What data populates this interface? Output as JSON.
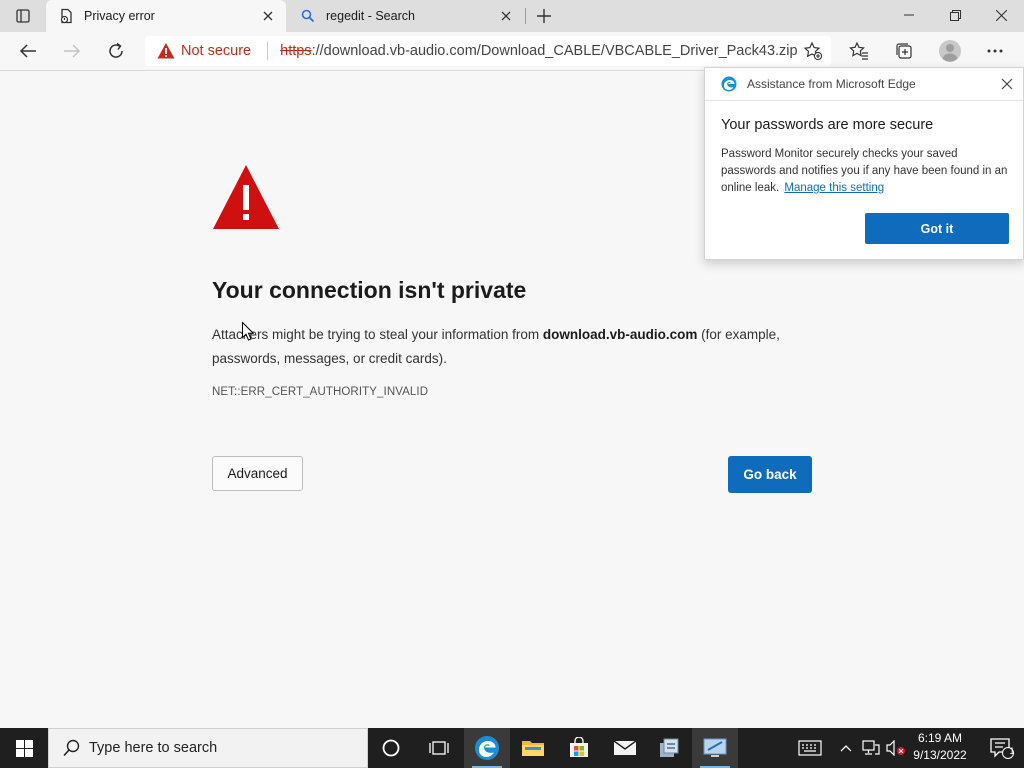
{
  "browser": {
    "tabs": [
      {
        "title": "Privacy error",
        "active": true
      },
      {
        "title": "regedit - Search",
        "active": false
      }
    ],
    "address": {
      "security_label": "Not secure",
      "scheme": "https",
      "rest": "://download.vb-audio.com/Download_CABLE/VBCABLE_Driver_Pack43.zip"
    }
  },
  "page": {
    "heading": "Your connection isn't private",
    "desc_prefix": "Attackers might be trying to steal your information from ",
    "desc_domain": "download.vb-audio.com",
    "desc_suffix": " (for example, passwords, messages, or credit cards).",
    "error_code": "NET::ERR_CERT_AUTHORITY_INVALID",
    "advanced_label": "Advanced",
    "go_back_label": "Go back"
  },
  "popup": {
    "title": "Assistance from Microsoft Edge",
    "heading": "Your passwords are more secure",
    "body": "Password Monitor securely checks your saved passwords and notifies you if any have been found in an online leak.",
    "link": "Manage this setting",
    "button": "Got it"
  },
  "taskbar": {
    "search_placeholder": "Type here to search",
    "time": "6:19 AM",
    "date": "9/13/2022",
    "notification_count": "1"
  },
  "colors": {
    "accent": "#0f6cbd",
    "danger": "#c42b1c",
    "warning_red": "#d01010"
  }
}
